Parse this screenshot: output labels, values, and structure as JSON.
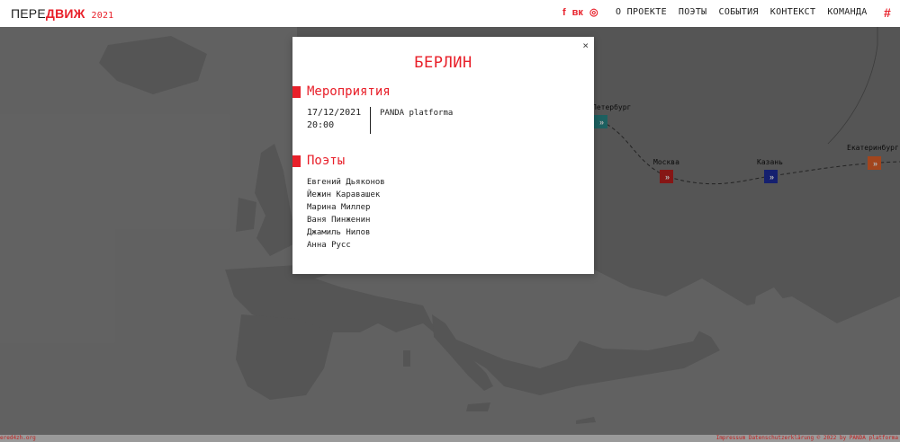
{
  "header": {
    "logo_pre": "ПЕРЕ",
    "logo_accent": "ДВИЖ",
    "logo_year": "2021",
    "social": [
      {
        "icon": "facebook-icon",
        "glyph": "f"
      },
      {
        "icon": "vk-icon",
        "glyph": "вк"
      },
      {
        "icon": "instagram-icon",
        "glyph": "◎"
      }
    ],
    "nav": [
      "О ПРОЕКТЕ",
      "ПОЭТЫ",
      "СОБЫТИЯ",
      "КОНТЕКСТ",
      "КОМАНДА"
    ],
    "hash_glyph": "#"
  },
  "map": {
    "cities": [
      {
        "name": "Петербург",
        "color": "#2a8a8a"
      },
      {
        "name": "Москва",
        "color": "#c0201f"
      },
      {
        "name": "Казань",
        "color": "#1f2ea0"
      },
      {
        "name": "Екатеринбург",
        "color": "#e8642a"
      }
    ],
    "marker_glyph": "»"
  },
  "modal": {
    "close_glyph": "×",
    "title": "БЕРЛИН",
    "events_heading": "Мероприятия",
    "event": {
      "date": "17/12/2021",
      "time": "20:00",
      "title": "PANDA platforma"
    },
    "poets_heading": "Поэты",
    "poets": [
      "Евгений Дьяконов",
      "Йежин Каравашек",
      "Марина Миллер",
      "Ваня Пинженин",
      "Джамиль Нилов",
      "Анна Русс"
    ]
  },
  "footer": {
    "left": "ered4zh.org",
    "links": "Impressum  Datenschutzerklärung  © 2022 by PANDA platforma"
  },
  "colors": {
    "accent": "#e8202a",
    "land": "#7a7a7a",
    "water": "#8c8c8c"
  }
}
